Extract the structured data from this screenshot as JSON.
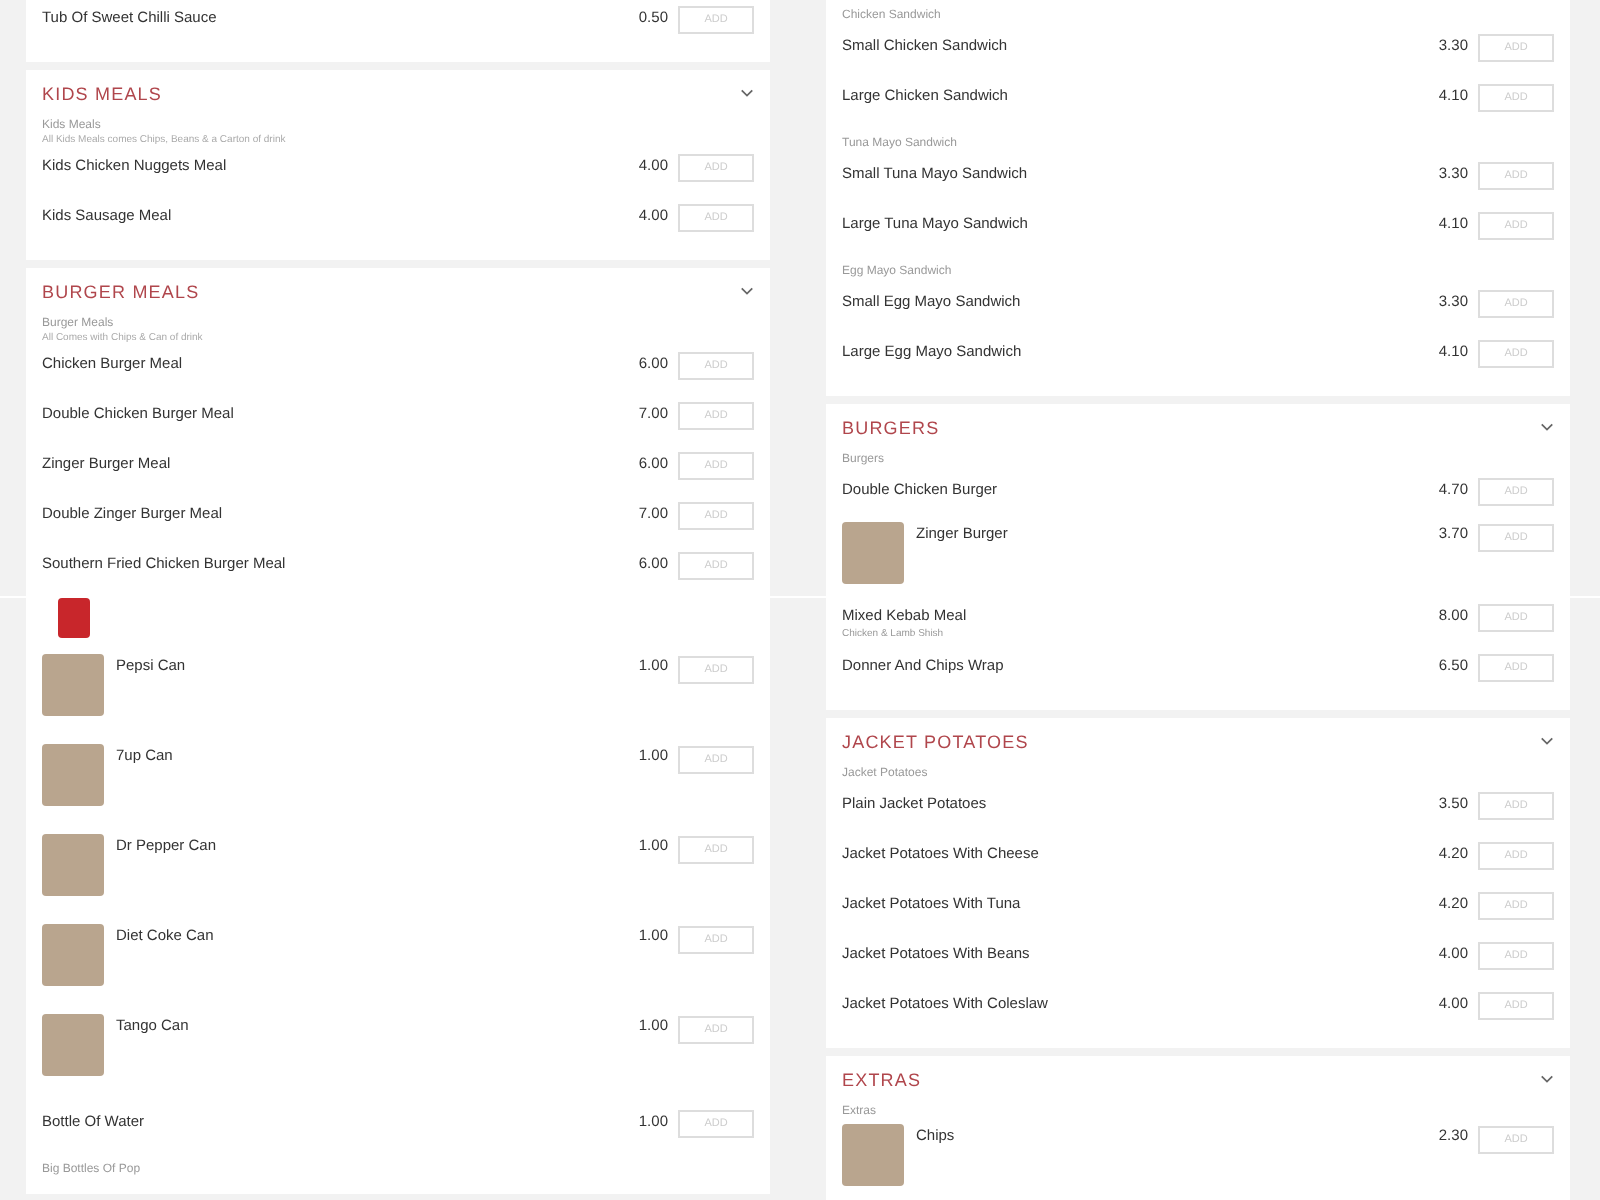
{
  "columns": [
    {
      "top": {
        "cards": [
          {
            "blocks": [
              {
                "kind": "item",
                "name": "Tub Of Sweet Chilli Sauce",
                "price": "0.50",
                "button": "ADD"
              }
            ]
          },
          {
            "title": "KIDS MEALS",
            "blocks": [
              {
                "kind": "label",
                "text": "Kids Meals"
              },
              {
                "kind": "note",
                "text": "All Kids Meals comes Chips, Beans & a Carton of drink"
              },
              {
                "kind": "item",
                "name": "Kids Chicken Nuggets Meal",
                "price": "4.00",
                "button": "ADD"
              },
              {
                "kind": "item",
                "name": "Kids Sausage Meal",
                "price": "4.00",
                "button": "ADD"
              }
            ]
          },
          {
            "title": "BURGER MEALS",
            "blocks": [
              {
                "kind": "label",
                "text": "Burger Meals"
              },
              {
                "kind": "note",
                "text": "All Comes with Chips & Can of drink"
              },
              {
                "kind": "item",
                "name": "Chicken Burger Meal",
                "price": "6.00",
                "button": "ADD"
              },
              {
                "kind": "item",
                "name": "Double Chicken Burger Meal",
                "price": "7.00",
                "button": "ADD"
              },
              {
                "kind": "item",
                "name": "Zinger Burger Meal",
                "price": "6.00",
                "button": "ADD"
              },
              {
                "kind": "item",
                "name": "Double Zinger Burger Meal",
                "price": "7.00",
                "button": "ADD"
              },
              {
                "kind": "item",
                "name": "Southern Fried Chicken Burger Meal",
                "price": "6.00",
                "button": "ADD"
              }
            ]
          }
        ]
      },
      "bottom": {
        "cards": [
          {
            "blocks": [
              {
                "kind": "photo"
              },
              {
                "kind": "image_item",
                "name": "Pepsi Can",
                "price": "1.00",
                "button": "ADD"
              },
              {
                "kind": "image_item",
                "name": "7up Can",
                "price": "1.00",
                "button": "ADD"
              },
              {
                "kind": "image_item",
                "name": "Dr Pepper Can",
                "price": "1.00",
                "button": "ADD"
              },
              {
                "kind": "image_item",
                "name": "Diet Coke Can",
                "price": "1.00",
                "button": "ADD"
              },
              {
                "kind": "image_item",
                "name": "Tango Can",
                "price": "1.00",
                "button": "ADD"
              },
              {
                "kind": "item",
                "name": "Bottle Of Water",
                "price": "1.00",
                "button": "ADD"
              },
              {
                "kind": "label",
                "text": "Big Bottles Of Pop"
              }
            ]
          }
        ]
      }
    },
    {
      "top": {
        "cards": [
          {
            "blocks": [
              {
                "kind": "label",
                "text": "Chicken Sandwich"
              },
              {
                "kind": "item",
                "name": "Small Chicken Sandwich",
                "price": "3.30",
                "button": "ADD"
              },
              {
                "kind": "item",
                "name": "Large Chicken Sandwich",
                "price": "4.10",
                "button": "ADD"
              },
              {
                "kind": "label",
                "text": "Tuna Mayo Sandwich"
              },
              {
                "kind": "item",
                "name": "Small Tuna Mayo Sandwich",
                "price": "3.30",
                "button": "ADD"
              },
              {
                "kind": "item",
                "name": "Large Tuna Mayo Sandwich",
                "price": "4.10",
                "button": "ADD"
              },
              {
                "kind": "label",
                "text": "Egg Mayo Sandwich"
              },
              {
                "kind": "item",
                "name": "Small Egg Mayo Sandwich",
                "price": "3.30",
                "button": "ADD"
              },
              {
                "kind": "item",
                "name": "Large Egg Mayo Sandwich",
                "price": "4.10",
                "button": "ADD"
              }
            ]
          },
          {
            "title": "BURGERS",
            "blocks": [
              {
                "kind": "label",
                "text": "Burgers"
              },
              {
                "kind": "item",
                "name": "Double Chicken Burger",
                "price": "4.70",
                "button": "ADD"
              },
              {
                "kind": "image_item",
                "name": "Zinger Burger",
                "price": "3.70",
                "button": "ADD"
              }
            ]
          }
        ]
      },
      "bottom": {
        "cards": [
          {
            "blocks": [
              {
                "kind": "item",
                "name": "Mixed Kebab Meal",
                "note": "Chicken & Lamb Shish",
                "price": "8.00",
                "button": "ADD"
              },
              {
                "kind": "item",
                "name": "Donner And Chips Wrap",
                "price": "6.50",
                "button": "ADD"
              }
            ]
          },
          {
            "title": "JACKET POTATOES",
            "blocks": [
              {
                "kind": "label",
                "text": "Jacket Potatoes"
              },
              {
                "kind": "item",
                "name": "Plain Jacket Potatoes",
                "price": "3.50",
                "button": "ADD"
              },
              {
                "kind": "item",
                "name": "Jacket Potatoes With Cheese",
                "price": "4.20",
                "button": "ADD"
              },
              {
                "kind": "item",
                "name": "Jacket Potatoes With Tuna",
                "price": "4.20",
                "button": "ADD"
              },
              {
                "kind": "item",
                "name": "Jacket Potatoes With Beans",
                "price": "4.00",
                "button": "ADD"
              },
              {
                "kind": "item",
                "name": "Jacket Potatoes With Coleslaw",
                "price": "4.00",
                "button": "ADD"
              }
            ]
          },
          {
            "title": "EXTRAS",
            "blocks": [
              {
                "kind": "label",
                "text": "Extras"
              },
              {
                "kind": "image_item",
                "name": "Chips",
                "price": "2.30",
                "button": "ADD"
              }
            ]
          }
        ]
      }
    }
  ]
}
